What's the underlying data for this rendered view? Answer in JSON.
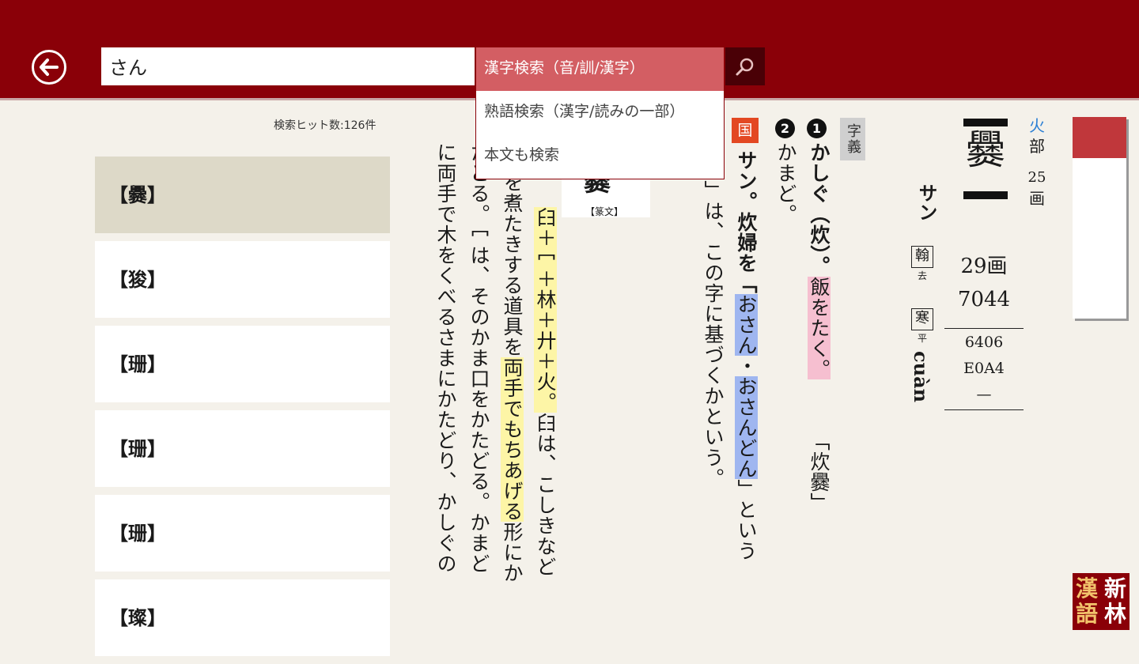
{
  "search": {
    "query": "さん"
  },
  "dropdown": {
    "options": [
      "漢字検索（音/訓/漢字）",
      "熟語検索（漢字/読みの一部）",
      "本文も検索"
    ],
    "active_index": 0
  },
  "results": {
    "hit_count": "検索ヒット数:126件",
    "items": [
      "【爨】",
      "【狻】",
      "【珊】",
      "【珊】",
      "【珊】",
      "【璨】"
    ],
    "selected_index": 0
  },
  "entry": {
    "head_kanji": "爨",
    "radical": {
      "char": "火",
      "label": "部",
      "count": "25",
      "unit": "画"
    },
    "on_reading": "サン",
    "rhymes": [
      {
        "char": "翰",
        "tone": "去"
      },
      {
        "char": "寒",
        "tone": "平"
      }
    ],
    "pinyin": "cuàn",
    "stroke_count": "29画",
    "code_main": "7044",
    "codes": [
      "6406",
      "E0A4",
      "—"
    ],
    "jigi_label": "字義",
    "kuni_label": "国",
    "meaning1": {
      "num": "1",
      "text_before": "かしぐ（炊）。",
      "highlight": "飯をたく。",
      "example": "「炊爨」"
    },
    "meaning2": {
      "num": "2",
      "text": "かまど。"
    },
    "kuni_text": {
      "lead": "サン。炊婦を「",
      "hl1": "おさん",
      "mid": "・",
      "hl2": "おさんどん",
      "tail": "」という",
      "col2": "」は、この字に基づくかという。"
    },
    "tensho_label": "【篆文】",
    "tensho_glyph": "爨",
    "etymology": {
      "col1_hl": "𦥑＋冖＋林＋廾＋火。",
      "col1_rest": "𦥑は、こしきなど",
      "col2_pre": "を煮たきする道具を",
      "col2_hl": "両手でもちあげる",
      "col2_post": "形にか",
      "col3": "たどる。冖は、そのかま口をかたどる。かまど",
      "col4": "に両手で木をくべるさまにかたどり、かしぐの"
    }
  },
  "logo": {
    "chars": [
      "漢",
      "新",
      "語",
      "林"
    ]
  }
}
